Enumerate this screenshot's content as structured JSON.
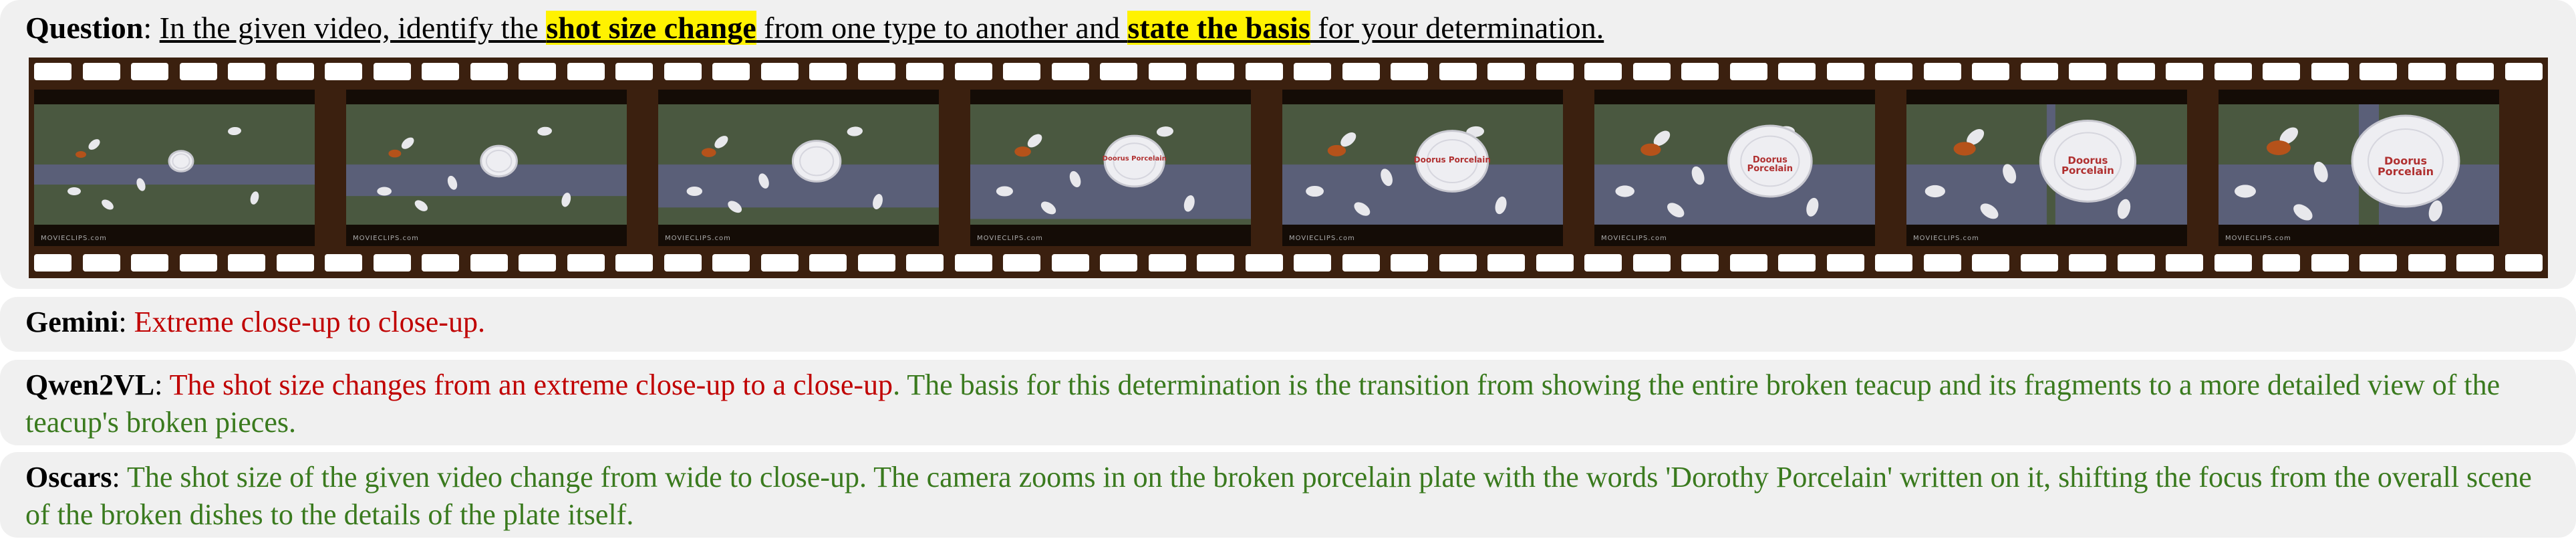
{
  "question": {
    "label": "Question",
    "sep": ": ",
    "text_1": "In the given video, identify the ",
    "highlight_1": "shot size change",
    "text_2": " from one type to another and ",
    "highlight_2": "state the basis",
    "text_3": " for your determination."
  },
  "filmstrip": {
    "frame_watermark": "MOVIECLIPS.com",
    "frames": [
      {
        "plate_text": ""
      },
      {
        "plate_text": ""
      },
      {
        "plate_text": ""
      },
      {
        "plate_text": "Doorus Porcelain"
      },
      {
        "plate_text": "Doorus Porcelain"
      },
      {
        "plate_text": "Doorus Porcelain"
      },
      {
        "plate_text": "Doorus Porcelain"
      },
      {
        "plate_text": "Doorus Porcelain"
      }
    ]
  },
  "answers": {
    "gemini": {
      "model": "Gemini",
      "sep": ": ",
      "red": "Extreme close-up to close-up.",
      "green": ""
    },
    "qwen": {
      "model": "Qwen2VL",
      "sep": ": ",
      "red": "The shot size changes from an extreme close-up to a close-up",
      "green": ". The basis for this determination is the transition from showing the entire broken teacup and its fragments to a more detailed view of the teacup's broken pieces."
    },
    "oscars": {
      "model": "Oscars",
      "sep": ": ",
      "red": "",
      "green": "The shot size of the given video change from wide to close-up. The camera zooms in on the broken porcelain plate with the words 'Dorothy Porcelain' written on it, shifting the focus from the overall scene of the broken dishes to the details of the plate itself."
    }
  }
}
